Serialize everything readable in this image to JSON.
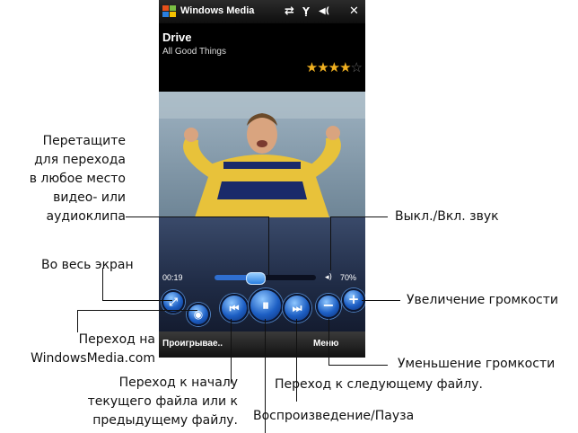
{
  "titlebar": {
    "app_title": "Windows Media",
    "icons": [
      "windows-flag-icon",
      "connectivity-icon",
      "signal-icon",
      "speaker-icon",
      "close-icon"
    ],
    "close_glyph": "✕",
    "sync_glyph": "⇄",
    "signal_glyph": "Ỵ",
    "speaker_glyph": "◀("
  },
  "now_playing": {
    "song": "Drive",
    "album": "All Good Things",
    "rating": 4,
    "rating_max": 5
  },
  "playback": {
    "elapsed": "00:19",
    "progress": 0.4,
    "volume_text": "70%",
    "volume_icon": "◂)"
  },
  "buttons": {
    "fullscreen": "⤢",
    "web": "◉",
    "prev": "⏮",
    "play_pause": "⏸",
    "next": "⏭",
    "vol_down": "−",
    "vol_up": "+"
  },
  "softkeys": {
    "left": "Проигрывае..",
    "right": "Меню"
  },
  "callouts": {
    "seek": [
      "Перетащите",
      "для перехода",
      "в любое место",
      "видео- или",
      "аудиоклипа"
    ],
    "mute": "Выкл./Вкл. звук",
    "fullscreen": "Во весь экран",
    "volume_up": "Увеличение громкости",
    "windowsmedia": [
      "Переход на",
      "WindowsMedia.com"
    ],
    "volume_down": "Уменьшение громкости",
    "prev": [
      "Переход к началу",
      "текущего файла или к",
      "предыдущему файлу."
    ],
    "next": "Переход к следующему файлу.",
    "play_pause": "Воспроизведение/Пауза"
  },
  "colors": {
    "accent_blue": "#1d5fc4",
    "star": "#f0b020"
  }
}
